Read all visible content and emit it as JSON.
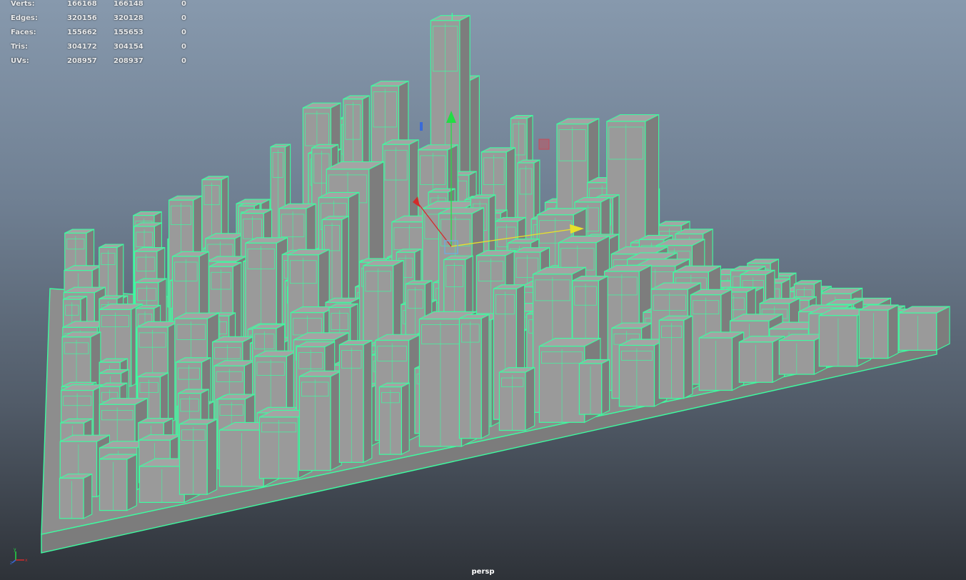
{
  "hud": {
    "rows": [
      {
        "label": "Verts:",
        "object": "166168",
        "selected": "166148",
        "component": "0"
      },
      {
        "label": "Edges:",
        "object": "320156",
        "selected": "320128",
        "component": "0"
      },
      {
        "label": "Faces:",
        "object": "155662",
        "selected": "155653",
        "component": "0"
      },
      {
        "label": "Tris:",
        "object": "304172",
        "selected": "304154",
        "component": "0"
      },
      {
        "label": "UVs:",
        "object": "208957",
        "selected": "208937",
        "component": "0"
      }
    ]
  },
  "viewport": {
    "camera": "persp",
    "wireframe_color": "#3dfca0",
    "surface_color": "#9a9a9a",
    "background_top": "#8799ad",
    "background_bottom": "#2e3238"
  },
  "manipulator": {
    "x_axis_color": "#d42a2a",
    "y_axis_color": "#22dd44",
    "z_axis_color": "#e8e02a",
    "center_handle_color": "#6ab0e0"
  },
  "axis_indicator": {
    "x_label": "x",
    "y_label": "y",
    "z_label": "z"
  }
}
